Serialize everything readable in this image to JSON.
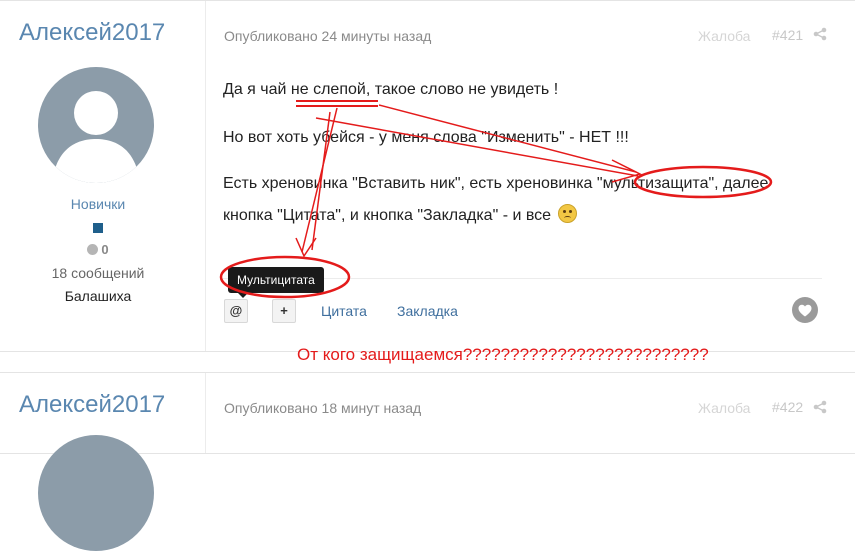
{
  "posts": [
    {
      "author": "Алексей2017",
      "group": "Новички",
      "reputation": "0",
      "posts_count": "18 сообщений",
      "location": "Балашиха",
      "published": "Опубликовано 24 минуты назад",
      "report": "Жалоба",
      "post_number": "#421",
      "content": {
        "line1": "Да я чай не слепой, такое слово не увидеть !",
        "line2": "Но вот хоть убейся - у меня слова \"Изменить\" - НЕТ !!!",
        "line3": "Есть хреновинка \"Вставить ник\", есть хреновинка \"мультизащита\", далее",
        "line4": "кнопка \"Цитата\", и кнопка \"Закладка\" - и все"
      },
      "tools": {
        "mention": "@",
        "multiquote": "+",
        "quote": "Цитата",
        "bookmark": "Закладка"
      },
      "tooltip": "Мультицитата"
    },
    {
      "author": "Алексей2017",
      "published": "Опубликовано 18 минут назад",
      "report": "Жалоба",
      "post_number": "#422"
    }
  ],
  "annotation": "От кого защищаемся??????????????????????????",
  "colors": {
    "annotation_red": "#e41b1b",
    "link_blue": "#3f6f9e",
    "username_blue": "#5a87b0"
  }
}
